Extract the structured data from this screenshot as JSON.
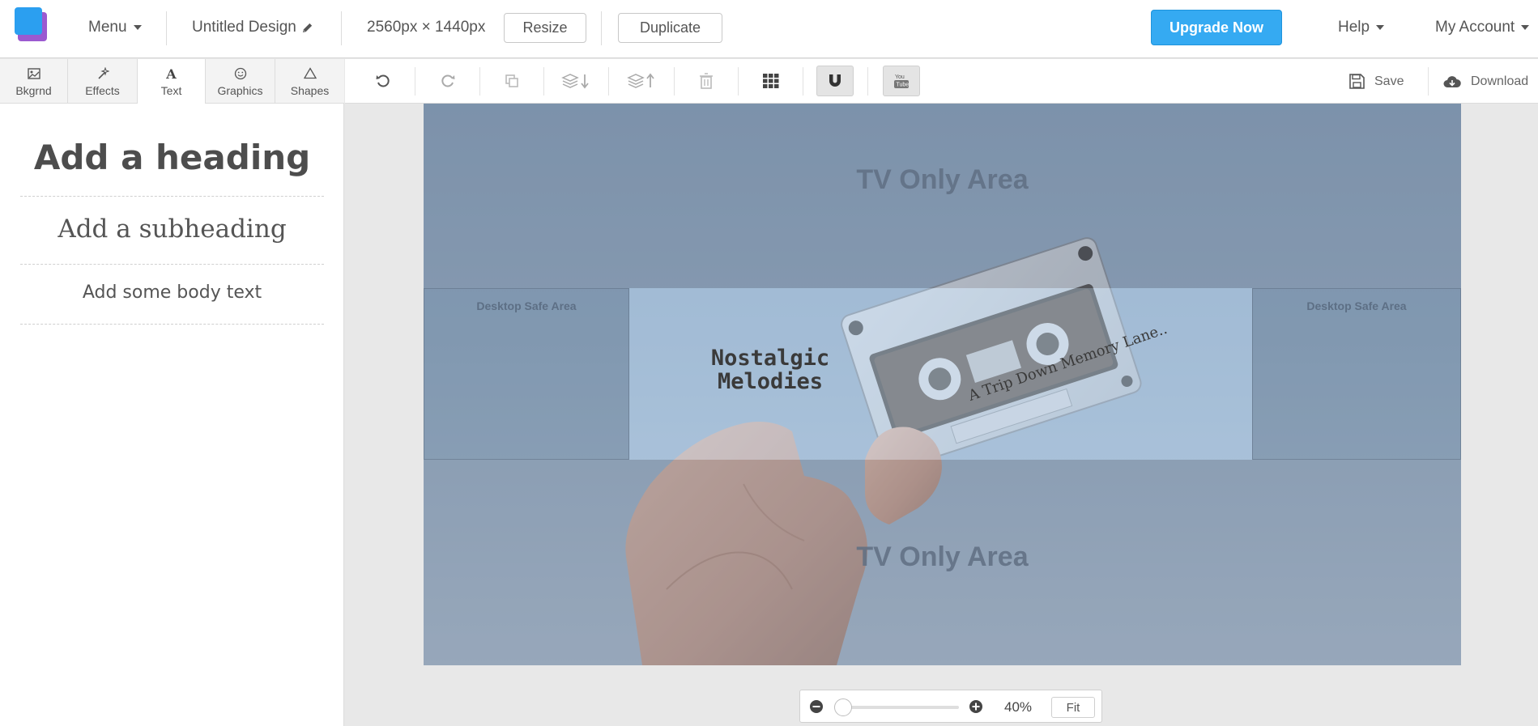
{
  "topbar": {
    "menu_label": "Menu",
    "design_title": "Untitled Design",
    "dimensions": "2560px × 1440px",
    "resize_label": "Resize",
    "duplicate_label": "Duplicate",
    "upgrade_label": "Upgrade Now",
    "help_label": "Help",
    "account_label": "My Account"
  },
  "tabs": [
    {
      "label": "Bkgrnd",
      "icon": "image-icon"
    },
    {
      "label": "Effects",
      "icon": "magic-wand-icon"
    },
    {
      "label": "Text",
      "icon": "text-icon",
      "active": true
    },
    {
      "label": "Graphics",
      "icon": "smiley-icon"
    },
    {
      "label": "Shapes",
      "icon": "triangle-icon"
    }
  ],
  "text_panel": {
    "heading": "Add a heading",
    "subheading": "Add a subheading",
    "body": "Add some body text"
  },
  "toolbar": {
    "tools": [
      "undo-icon",
      "redo-icon",
      "copy-icon",
      "send-backward-icon",
      "bring-forward-icon",
      "trash-icon",
      "grid-icon",
      "magnet-icon",
      "youtube-icon"
    ],
    "save_label": "Save",
    "download_label": "Download"
  },
  "canvas": {
    "tv_area_label": "TV Only Area",
    "desktop_safe_label": "Desktop Safe Area",
    "title_line1": "Nostalgic",
    "title_line2": "Melodies",
    "tagline": "A Trip Down Memory Lane.."
  },
  "zoom": {
    "percent": "40%",
    "fit_label": "Fit",
    "level": 0.4
  },
  "colors": {
    "accent": "#35aaf2",
    "logo_blue": "#2b9ff0",
    "logo_purple": "#9b59d0"
  }
}
